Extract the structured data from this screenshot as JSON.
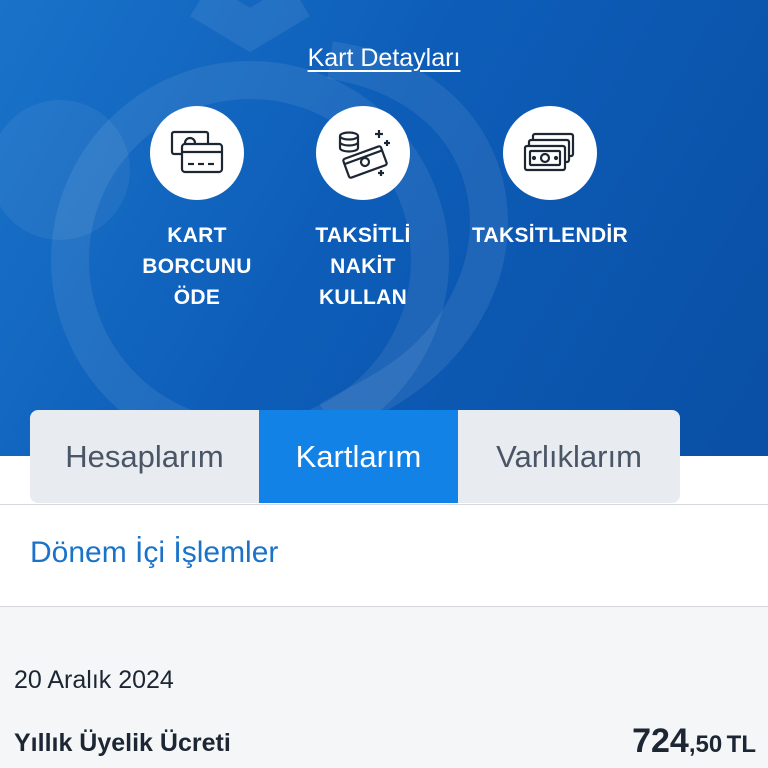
{
  "header": {
    "card_details_link": "Kart Detayları"
  },
  "actions": [
    {
      "label": "KART\nBORCUNU\nÖDE",
      "icon": "card-payment-icon"
    },
    {
      "label": "TAKSİTLİ\nNAKİT\nKULLAN",
      "icon": "cash-coins-icon"
    },
    {
      "label": "TAKSİTLENDİR",
      "icon": "banknotes-icon"
    }
  ],
  "tabs": [
    {
      "label": "Hesaplarım",
      "active": false
    },
    {
      "label": "Kartlarım",
      "active": true
    },
    {
      "label": "Varlıklarım",
      "active": false
    }
  ],
  "section": {
    "title": "Dönem İçi İşlemler"
  },
  "transaction": {
    "date": "20 Aralık 2024",
    "description": "Yıllık Üyelik Ücreti",
    "amount_integer": "724",
    "amount_decimal": ",50",
    "currency": "TL"
  },
  "colors": {
    "accent": "#1382e6",
    "hero": "#0d5db8",
    "link": "#1a73c9"
  }
}
